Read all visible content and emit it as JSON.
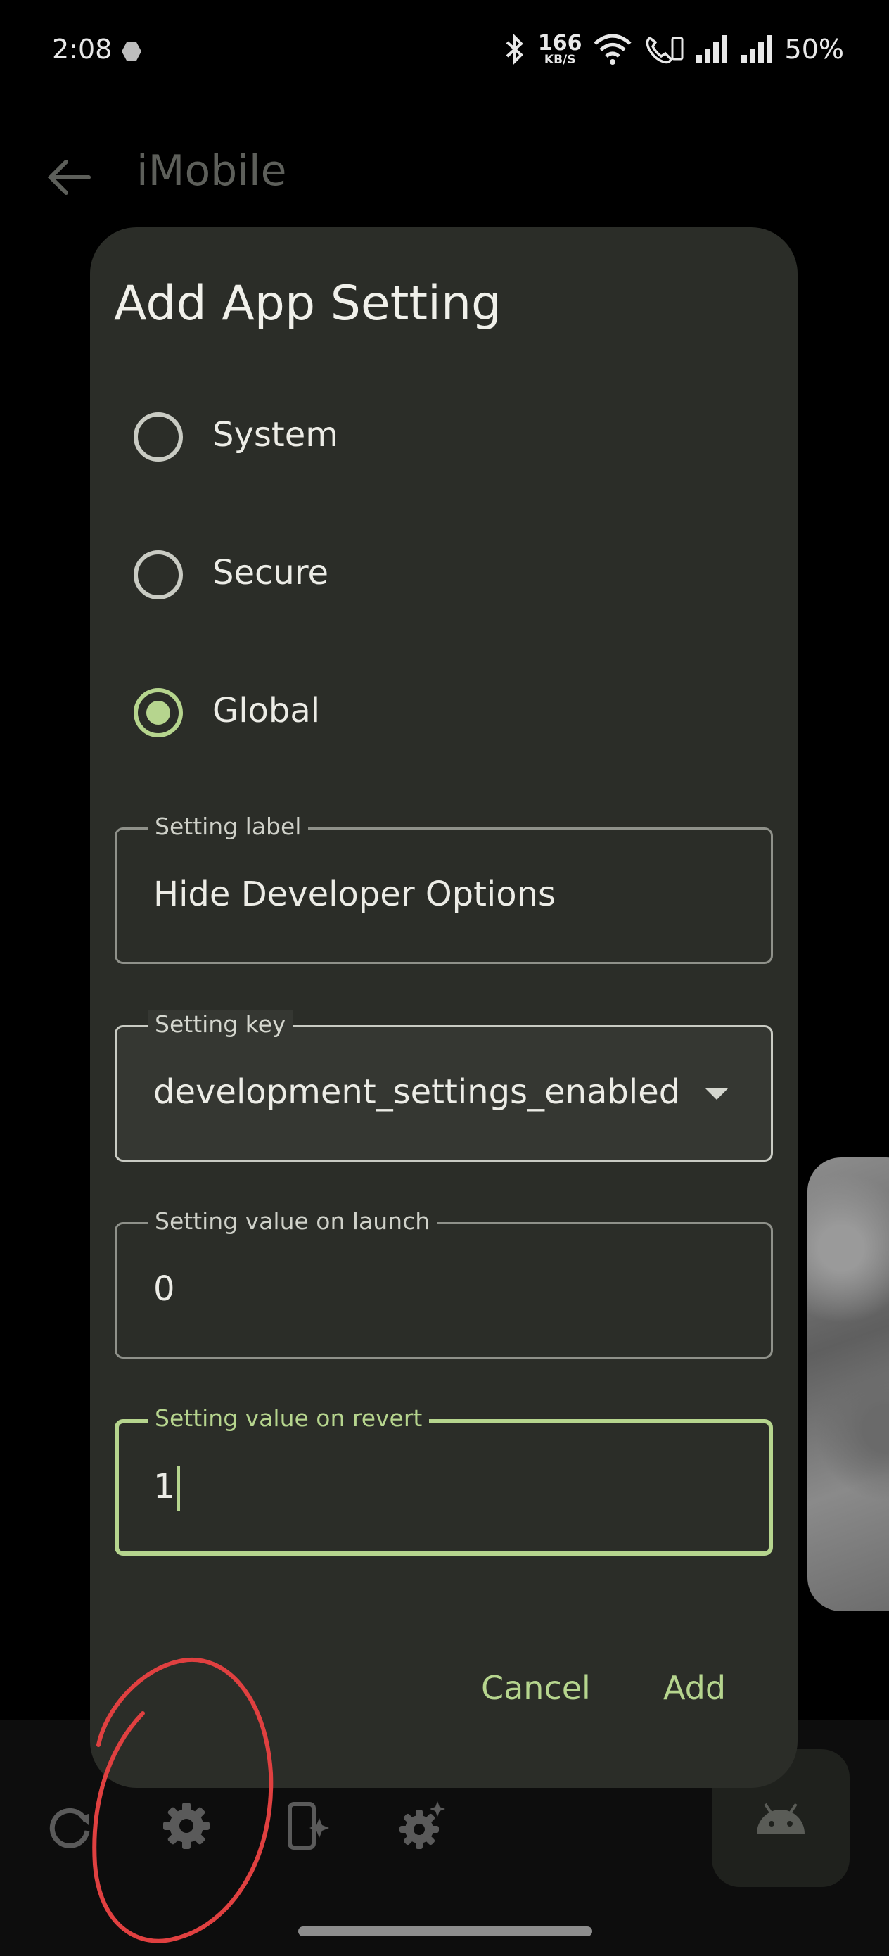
{
  "status_bar": {
    "time": "2:08",
    "net_speed": "166",
    "net_unit": "KB/S",
    "battery": "50%"
  },
  "app_bar": {
    "title": "iMobile"
  },
  "dialog": {
    "title": "Add App Setting",
    "radio_options": [
      {
        "label": "System",
        "selected": false
      },
      {
        "label": "Secure",
        "selected": false
      },
      {
        "label": "Global",
        "selected": true
      }
    ],
    "fields": {
      "label": {
        "legend": "Setting label",
        "value": "Hide Developer Options"
      },
      "key": {
        "legend": "Setting key",
        "value": "development_settings_enabled"
      },
      "launch": {
        "legend": "Setting value on launch",
        "value": "0"
      },
      "revert": {
        "legend": "Setting value on revert",
        "value": "1"
      }
    },
    "buttons": {
      "cancel": "Cancel",
      "add": "Add"
    }
  },
  "colors": {
    "accent": "#b6d58e",
    "dialog_bg": "#2b2d28",
    "annotation": "#e04040"
  },
  "icons": [
    "back-arrow-icon",
    "refresh-icon",
    "gear-icon",
    "app-sparkle-icon",
    "gear-sparkle-icon",
    "android-icon"
  ]
}
